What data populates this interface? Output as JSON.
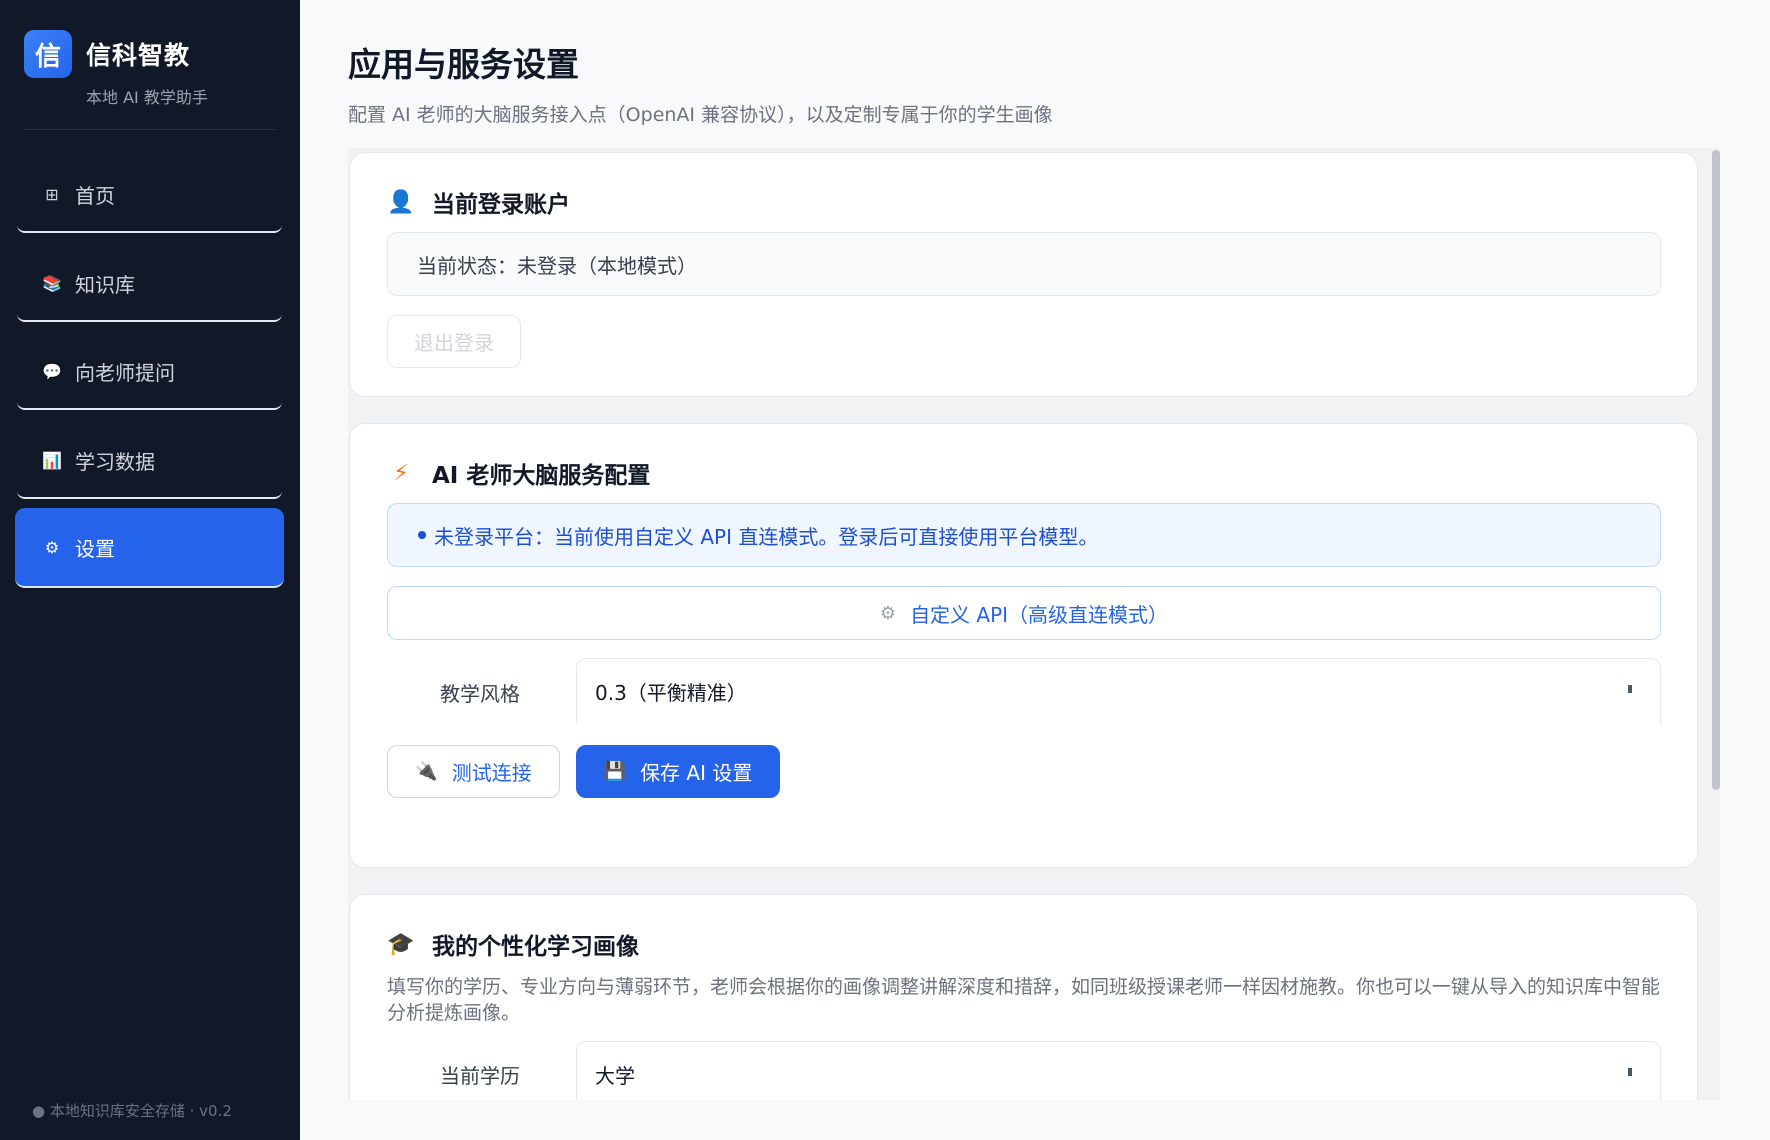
{
  "sidebar": {
    "logo_char": "信",
    "app_name": "信科智教",
    "app_sub": "本地 AI 教学助手",
    "items": [
      {
        "label": "首页",
        "icon": "⊞",
        "active": false
      },
      {
        "label": "知识库",
        "icon": "📚",
        "active": false
      },
      {
        "label": "向老师提问",
        "icon": "💬",
        "active": false
      },
      {
        "label": "学习数据",
        "icon": "📊",
        "active": false
      },
      {
        "label": "设置",
        "icon": "⚙",
        "active": true
      }
    ],
    "footer": "● 本地知识库安全存储 · v0.2"
  },
  "page": {
    "title": "应用与服务设置",
    "description": "配置 AI 老师的大脑服务接入点（OpenAI 兼容协议），以及定制专属于你的学生画像"
  },
  "account_card": {
    "title": "当前登录账户",
    "icon": "👤",
    "status": "当前状态：未登录（本地模式）",
    "logout_label": "退出登录"
  },
  "ai_card": {
    "title": "AI 老师大脑服务配置",
    "icon": "⚡",
    "notice": "未登录平台：当前使用自定义 API 直连模式。登录后可直接使用平台模型。",
    "mode_icon": "⚙",
    "mode_label": "自定义 API（高级直连模式）",
    "style_label": "教学风格",
    "style_value": "0.3（平衡精准）",
    "test_icon": "🔌",
    "test_label": "测试连接",
    "save_icon": "💾",
    "save_label": "保存 AI 设置"
  },
  "profile_card": {
    "title": "我的个性化学习画像",
    "icon": "🎓",
    "description": "填写你的学历、专业方向与薄弱环节，老师会根据你的画像调整讲解深度和措辞，如同班级授课老师一样因材施教。你也可以一键从导入的知识库中智能分析提炼画像。",
    "education_label": "当前学历",
    "education_value": "大学"
  }
}
